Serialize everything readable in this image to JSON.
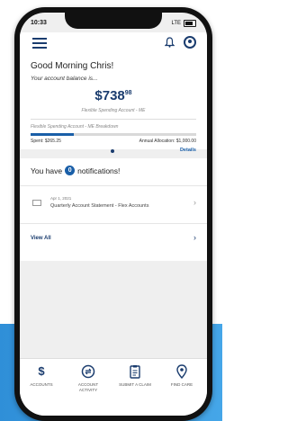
{
  "status_bar": {
    "time": "10:33",
    "signal": "LTE"
  },
  "header": {
    "menu_icon": "hamburger-icon",
    "bell_icon": "bell-icon",
    "profile_icon": "profile-icon"
  },
  "balance": {
    "greeting": "Good Morning Chris!",
    "subtitle": "Your account balance is...",
    "amount_main": "$738",
    "amount_cents": "98",
    "account_name": "Flexible Spending Account - ME",
    "breakdown_title": "Flexible Spending Account - ME Breakdown",
    "progress_fraction": 0.26,
    "spent": "Spent: $265.25",
    "allocation": "Annual Allocation: $1,000.00",
    "details_link": "Details"
  },
  "notifications": {
    "prefix": "You have",
    "count": "0",
    "suffix": "notifications!",
    "item": {
      "date": "Apr 1, 2021",
      "text": "Quarterly Account Statement - Flex Accounts"
    },
    "view_all": "View All"
  },
  "bottom_nav": [
    {
      "label": "ACCOUNTS",
      "icon": "dollar-icon"
    },
    {
      "label": "ACCOUNT ACTIVITY",
      "icon": "activity-icon"
    },
    {
      "label": "SUBMIT A CLAIM",
      "icon": "clipboard-icon"
    },
    {
      "label": "FIND CARE",
      "icon": "location-pin-icon"
    }
  ],
  "colors": {
    "brand": "#1a3c6e",
    "accent": "#1a5fa8",
    "background_blue": "#2f8fd8"
  }
}
